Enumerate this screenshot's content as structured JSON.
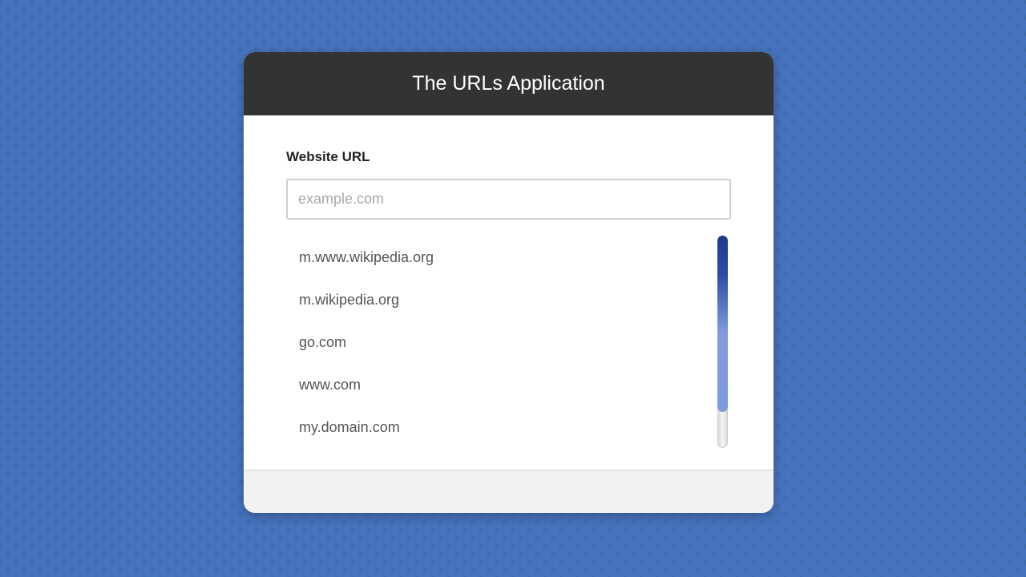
{
  "app": {
    "title": "The URLs Application"
  },
  "form": {
    "label": "Website URL",
    "input": {
      "value": "",
      "placeholder": "example.com"
    }
  },
  "suggestions": [
    "m.www.wikipedia.org",
    "m.wikipedia.org",
    "go.com",
    "www.com",
    "my.domain.com"
  ],
  "colors": {
    "background": "#4673bd",
    "header": "#333333",
    "scrollbar_thumb_top": "#1e3a8f",
    "scrollbar_thumb_bottom": "#7e9ade"
  }
}
